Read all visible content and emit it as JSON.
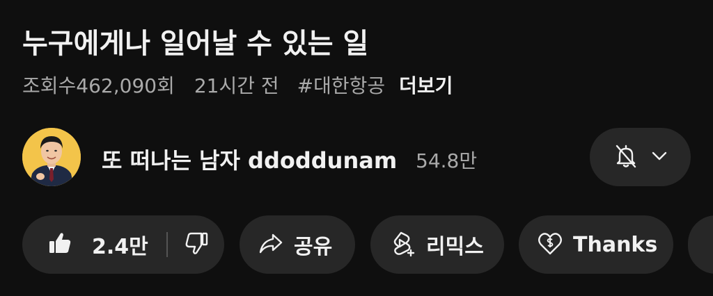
{
  "video": {
    "title": "누구에게나 일어날 수 있는 일",
    "views": "조회수462,090회",
    "time_ago": "21시간 전",
    "hashtag": "#대한항공",
    "more_label": "더보기"
  },
  "channel": {
    "name": "또 떠나는 남자 ddoddunam",
    "subscribers": "54.8만",
    "avatar_bg": "#f3c44a"
  },
  "notify": {
    "icon": "bell-off-icon",
    "chevron": "chevron-down-icon"
  },
  "actions": {
    "like_count": "2.4만",
    "share_label": "공유",
    "remix_label": "리믹스",
    "thanks_label": "Thanks"
  },
  "colors": {
    "background": "#0f0f0f",
    "pill": "#272727",
    "text": "#f1f1f1",
    "secondary_text": "#aaaaaa"
  }
}
